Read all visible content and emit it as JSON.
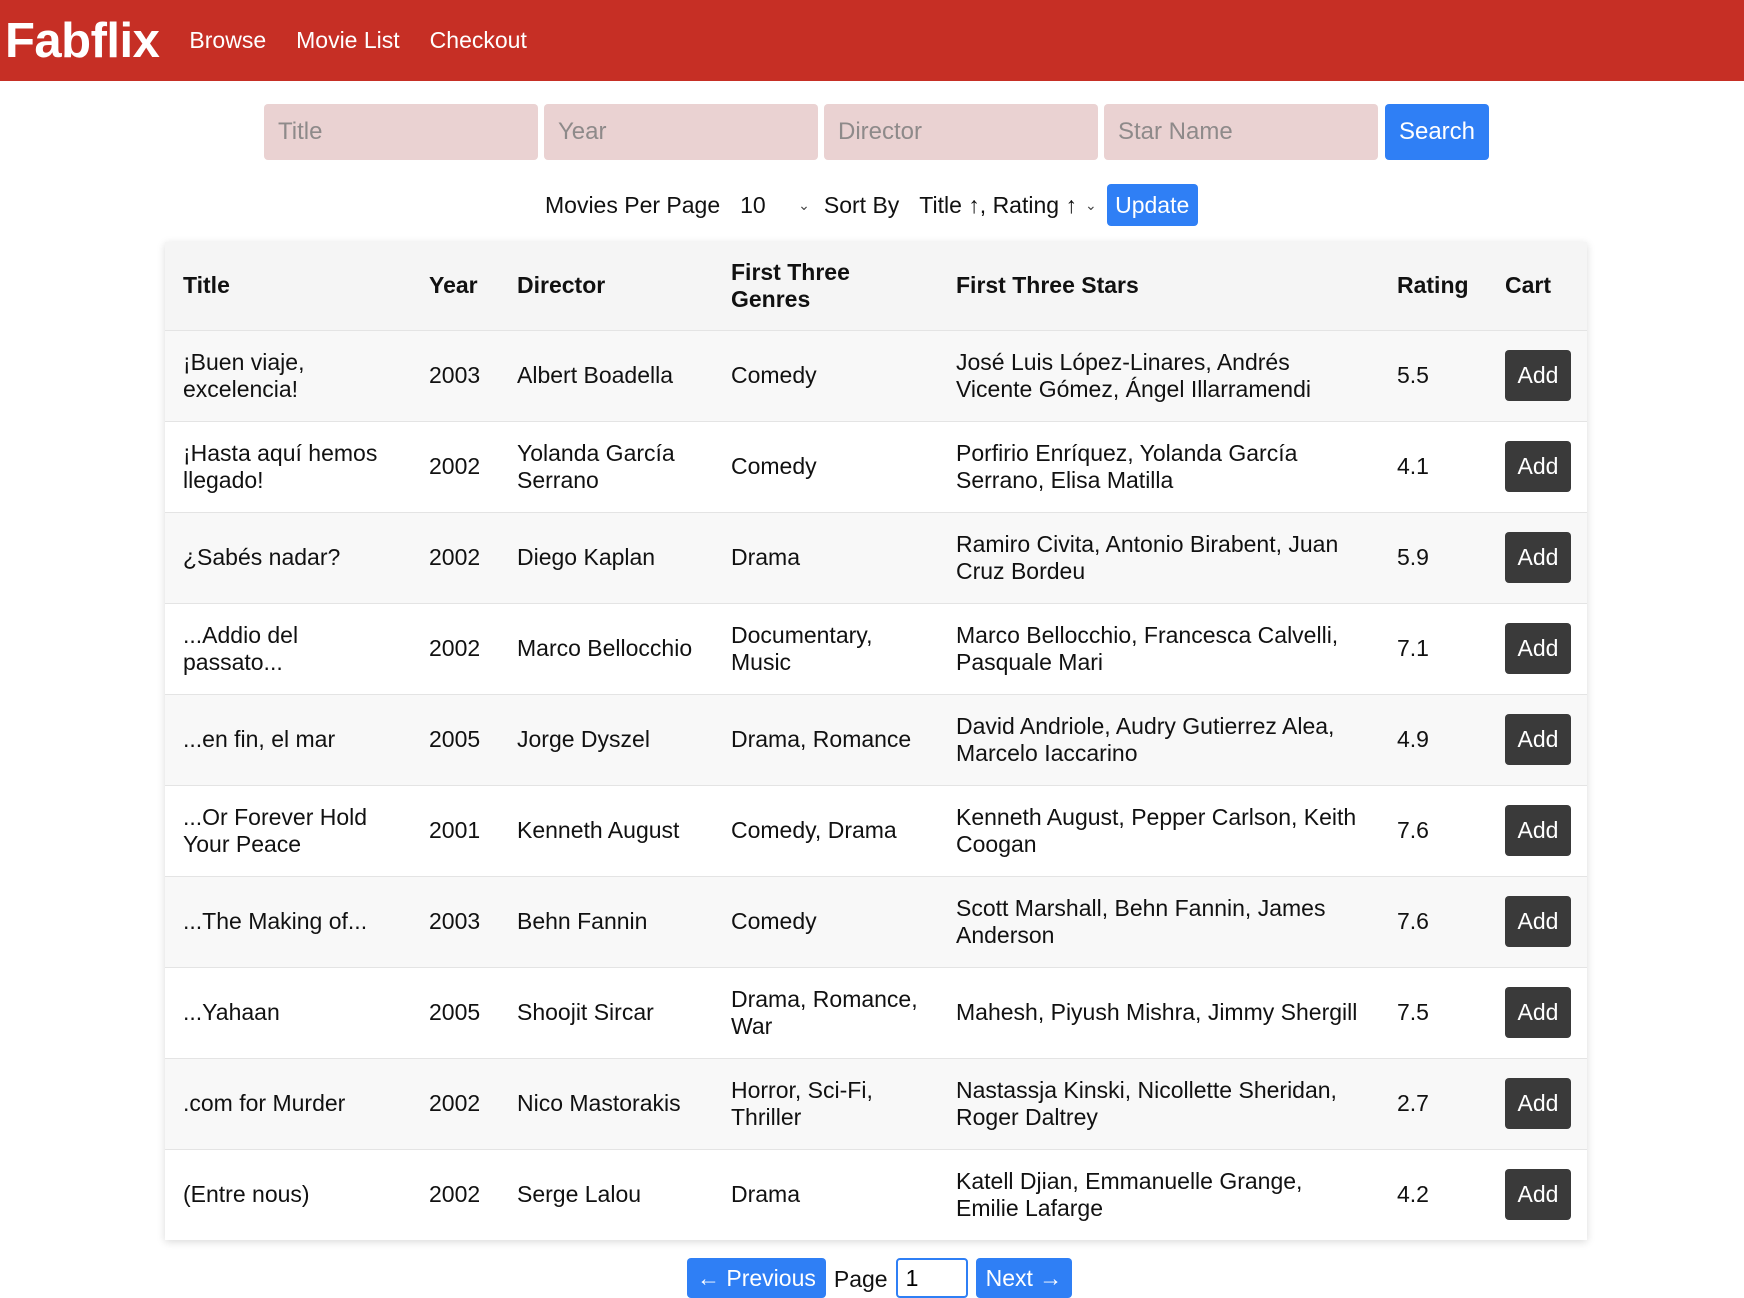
{
  "nav": {
    "brand": "Fabflix",
    "links": [
      "Browse",
      "Movie List",
      "Checkout"
    ]
  },
  "search": {
    "title_placeholder": "Title",
    "year_placeholder": "Year",
    "director_placeholder": "Director",
    "star_placeholder": "Star Name",
    "button_label": "Search"
  },
  "controls": {
    "per_page_label": "Movies Per Page",
    "per_page_value": "10",
    "sort_label": "Sort By",
    "sort_value": "Title ↑, Rating ↑",
    "update_label": "Update"
  },
  "table": {
    "headers": [
      "Title",
      "Year",
      "Director",
      "First Three Genres",
      "First Three Stars",
      "Rating",
      "Cart"
    ],
    "add_label": "Add",
    "rows": [
      {
        "title": "¡Buen viaje, excelencia!",
        "year": "2003",
        "director": "Albert Boadella",
        "genres": "Comedy",
        "stars": "José Luis López-Linares, Andrés Vicente Gómez, Ángel Illarramendi",
        "rating": "5.5"
      },
      {
        "title": "¡Hasta aquí hemos llegado!",
        "year": "2002",
        "director": "Yolanda García Serrano",
        "genres": "Comedy",
        "stars": "Porfirio Enríquez, Yolanda García Serrano, Elisa Matilla",
        "rating": "4.1"
      },
      {
        "title": "¿Sabés nadar?",
        "year": "2002",
        "director": "Diego Kaplan",
        "genres": "Drama",
        "stars": "Ramiro Civita, Antonio Birabent, Juan Cruz Bordeu",
        "rating": "5.9"
      },
      {
        "title": "...Addio del passato...",
        "year": "2002",
        "director": "Marco Bellocchio",
        "genres": "Documentary, Music",
        "stars": "Marco Bellocchio, Francesca Calvelli, Pasquale Mari",
        "rating": "7.1"
      },
      {
        "title": "...en fin, el mar",
        "year": "2005",
        "director": "Jorge Dyszel",
        "genres": "Drama, Romance",
        "stars": "David Andriole, Audry Gutierrez Alea, Marcelo Iaccarino",
        "rating": "4.9"
      },
      {
        "title": "...Or Forever Hold Your Peace",
        "year": "2001",
        "director": "Kenneth August",
        "genres": "Comedy, Drama",
        "stars": "Kenneth August, Pepper Carlson, Keith Coogan",
        "rating": "7.6"
      },
      {
        "title": "...The Making of...",
        "year": "2003",
        "director": "Behn Fannin",
        "genres": "Comedy",
        "stars": "Scott Marshall, Behn Fannin, James Anderson",
        "rating": "7.6"
      },
      {
        "title": "...Yahaan",
        "year": "2005",
        "director": "Shoojit Sircar",
        "genres": "Drama, Romance, War",
        "stars": "Mahesh, Piyush Mishra, Jimmy Shergill",
        "rating": "7.5"
      },
      {
        "title": ".com for Murder",
        "year": "2002",
        "director": "Nico Mastorakis",
        "genres": "Horror, Sci-Fi, Thriller",
        "stars": "Nastassja Kinski, Nicollette Sheridan, Roger Daltrey",
        "rating": "2.7"
      },
      {
        "title": "(Entre nous)",
        "year": "2002",
        "director": "Serge Lalou",
        "genres": "Drama",
        "stars": "Katell Djian, Emmanuelle Grange, Emilie Lafarge",
        "rating": "4.2"
      }
    ]
  },
  "pager": {
    "previous_label": "← Previous",
    "page_label": "Page",
    "page_value": "1",
    "next_label": "Next →"
  },
  "colors": {
    "navbar": "#c62f25",
    "primary_button": "#2f7ff5",
    "add_button": "#3a3a3a",
    "input_background": "#ead2d2"
  }
}
